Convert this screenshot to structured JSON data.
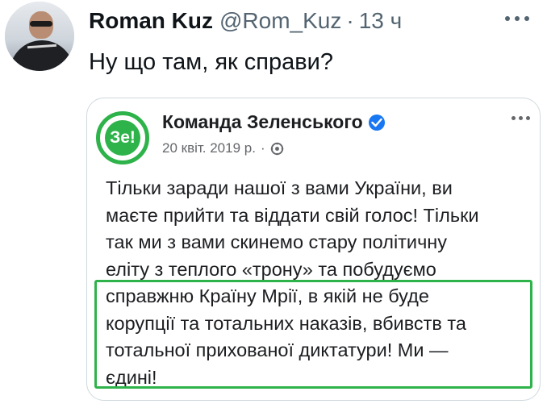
{
  "tweet": {
    "author_name": "Roman Kuz",
    "handle": "@Rom_Kuz",
    "separator": "·",
    "time": "13 ч",
    "text": "Ну що там, як справи?",
    "icons": {
      "avatar": "user-avatar",
      "more": "more-horizontal-icon"
    }
  },
  "embedded_post": {
    "logo_text": "Зе!",
    "page_name": "Команда Зеленського",
    "date": "20 квіт. 2019 р.",
    "date_separator": "·",
    "icons": {
      "verified": "verified-badge-icon",
      "audience": "globe-icon",
      "more": "more-horizontal-icon"
    },
    "body_lines": [
      "Тільки заради нашої з вами України, ви",
      "маєте прийти та віддати свій голос! Тільки",
      "так ми з вами скинемо стару політичну",
      "еліту з теплого «трону» та побудуємо",
      "справжню Країну Мрії, в якій не буде",
      "корупції та тотальних наказів, вбивств та",
      "тотальної прихованої диктатури! Ми —",
      "єдині!"
    ],
    "highlight_color": "#2eb34a"
  }
}
